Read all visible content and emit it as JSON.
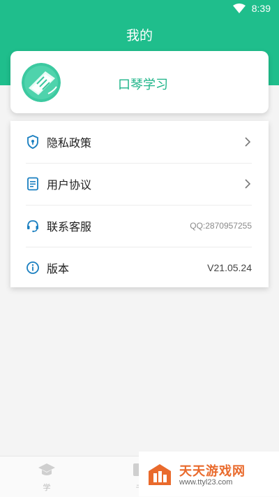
{
  "status_bar": {
    "time": "8:39"
  },
  "header": {
    "title": "我的"
  },
  "profile": {
    "name": "口琴学习"
  },
  "menu": {
    "items": [
      {
        "label": "隐私政策",
        "icon": "shield-icon",
        "action": "chevron"
      },
      {
        "label": "用户协议",
        "icon": "document-icon",
        "action": "chevron"
      },
      {
        "label": "联系客服",
        "icon": "headset-icon",
        "value": "QQ:2870957255"
      },
      {
        "label": "版本",
        "icon": "info-icon",
        "value": "V21.05.24"
      }
    ]
  },
  "bottom_nav": {
    "items": [
      {
        "label": "学",
        "icon": "graduation-cap-icon"
      },
      {
        "label": "书",
        "icon": "book-icon"
      }
    ]
  },
  "watermark": {
    "title": "天天游戏网",
    "url": "www.ttyl23.com"
  },
  "colors": {
    "brand_green": "#1fbe8c",
    "accent_text": "#1db488",
    "icon_blue": "#1a7fc0",
    "watermark_orange": "#e96a2c"
  }
}
